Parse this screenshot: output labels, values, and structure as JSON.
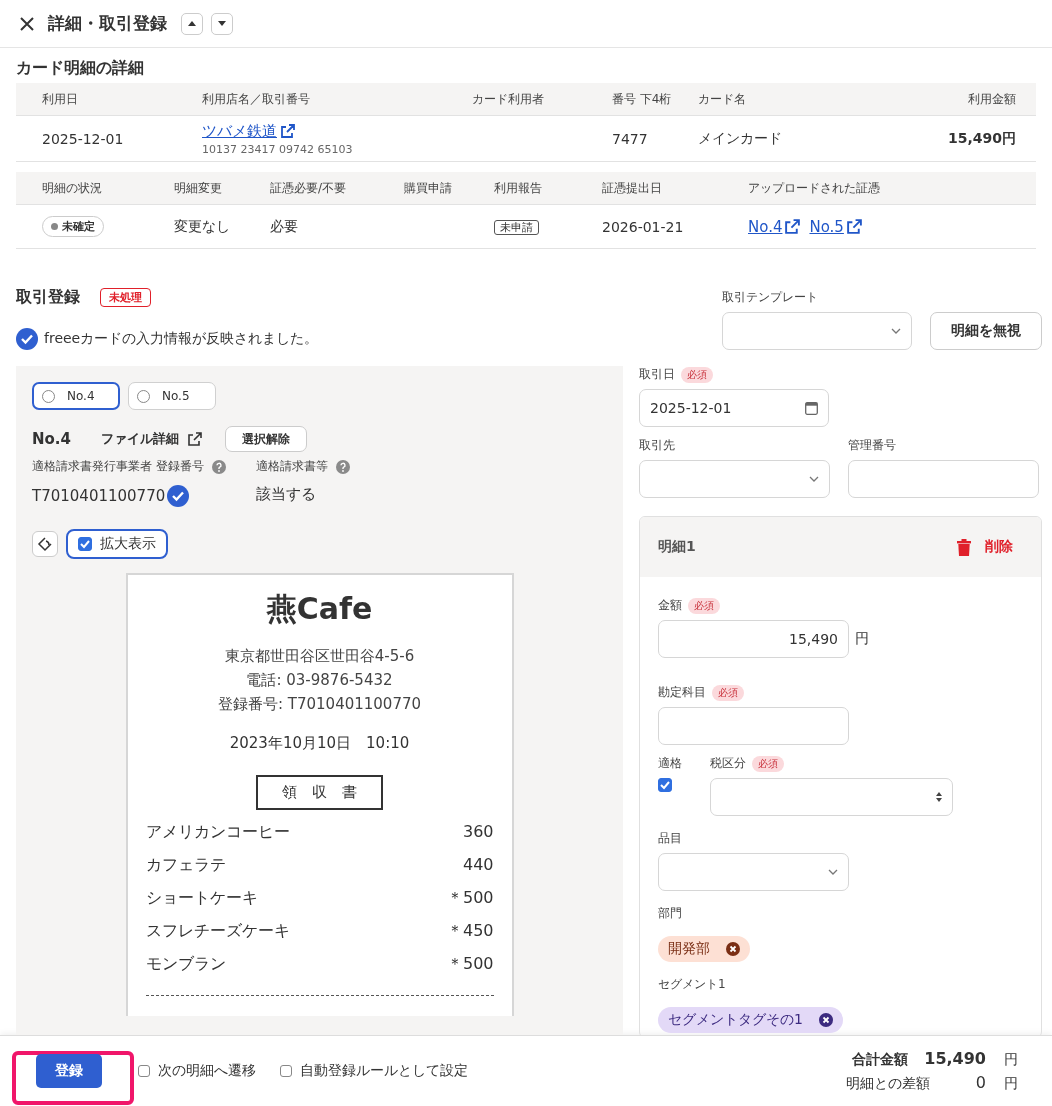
{
  "header": {
    "title": "詳細・取引登録"
  },
  "card_detail": {
    "title": "カード明細の詳細",
    "columns": [
      "利用日",
      "利用店名／取引番号",
      "カード利用者",
      "番号 下4桁",
      "カード名",
      "利用金額"
    ],
    "row": {
      "date": "2025-12-01",
      "merchant": "ツバメ鉄道",
      "transaction_no": "10137 23417 09742 65103",
      "last4": "7477",
      "card_name": "メインカード",
      "amount": "15,490円"
    },
    "status_columns": [
      "明細の状況",
      "明細変更",
      "証憑必要/不要",
      "購買申請",
      "利用報告",
      "証憑提出日",
      "アップロードされた証憑"
    ],
    "status_row": {
      "status": "未確定",
      "change": "変更なし",
      "receipt_required": "必要",
      "usage_report": "未申請",
      "receipt_date": "2026-01-21",
      "uploads": [
        "No.4",
        "No.5"
      ]
    }
  },
  "registration": {
    "title": "取引登録",
    "badge": "未処理",
    "notice": "freeeカードの入力情報が反映されました。",
    "template_label": "取引テンプレート",
    "ignore_button": "明細を無視"
  },
  "evidence": {
    "options": [
      {
        "label": "No.4",
        "selected": true
      },
      {
        "label": "No.5",
        "selected": false
      }
    ],
    "current": "No.4",
    "file_detail": "ファイル詳細",
    "clear_button": "選択解除",
    "fields": [
      {
        "label": "適格請求書発行事業者 登録番号",
        "value": "T7010401100770",
        "verified": true
      },
      {
        "label": "適格請求書等",
        "value": "該当する",
        "verified": false
      }
    ],
    "zoom": {
      "label": "拡大表示",
      "checked": true
    },
    "receipt": {
      "shop": "燕Cafe",
      "lines": [
        "東京都世田谷区世田谷4-5-6",
        "電話: 03-9876-5432",
        "登録番号:  T7010401100770"
      ],
      "datetime": "2023年10月10日　10:10",
      "doc_title": "領　収　書",
      "items": [
        {
          "name": "アメリカンコーヒー",
          "price": "360"
        },
        {
          "name": "カフェラテ",
          "price": "440"
        },
        {
          "name": "ショートケーキ",
          "price": "＊500"
        },
        {
          "name": "スフレチーズケーキ",
          "price": "＊450"
        },
        {
          "name": "モンブラン",
          "price": "＊500"
        }
      ]
    }
  },
  "form": {
    "date": {
      "label": "取引日",
      "badge": "必須",
      "value": "2025-12-01"
    },
    "partner": {
      "label": "取引先"
    },
    "mgmt_no": {
      "label": "管理番号"
    },
    "line": {
      "title": "明細1",
      "delete": "削除",
      "amount": {
        "label": "金額",
        "badge": "必須",
        "value": "15,490",
        "unit": "円"
      },
      "account": {
        "label": "勘定科目",
        "badge": "必須"
      },
      "qualified": {
        "label": "適格",
        "checked": true
      },
      "tax": {
        "label": "税区分",
        "badge": "必須"
      },
      "item": {
        "label": "品目"
      },
      "department": {
        "label": "部門",
        "tags": [
          {
            "label": "開発部",
            "kind": "department"
          }
        ]
      },
      "segment": {
        "label": "セグメント1",
        "tags": [
          {
            "label": "セグメントタグその1",
            "kind": "segment"
          }
        ]
      }
    }
  },
  "footer": {
    "submit": "登録",
    "highlighted": true,
    "options": [
      {
        "label": "次の明細へ遷移",
        "checked": false
      },
      {
        "label": "自動登録ルールとして設定",
        "checked": false
      }
    ],
    "total_label": "合計金額",
    "total": "15,490",
    "total_unit": "円",
    "diff_label": "明細との差額",
    "diff": "0",
    "diff_unit": "円"
  }
}
